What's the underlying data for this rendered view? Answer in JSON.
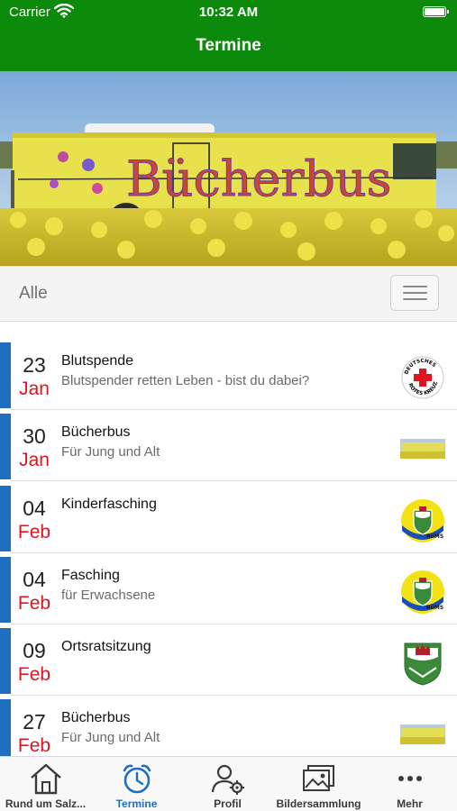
{
  "status": {
    "carrier": "Carrier",
    "time": "10:32 AM"
  },
  "nav": {
    "title": "Termine"
  },
  "banner": {
    "bus_text": "Bücherbus"
  },
  "filter": {
    "label": "Alle",
    "menu_icon": "hamburger-icon"
  },
  "events": [
    {
      "day": "23",
      "month": "Jan",
      "title": "Blutspende",
      "subtitle": "Blutspender retten Leben - bist du dabei?",
      "thumb": "drk-logo",
      "thumb_text": "DEUTSCHES ROTES KREUZ"
    },
    {
      "day": "30",
      "month": "Jan",
      "title": "Bücherbus",
      "subtitle": "Für Jung und Alt",
      "thumb": "bus-photo"
    },
    {
      "day": "04",
      "month": "Feb",
      "title": "Kinderfasching",
      "subtitle": "",
      "thumb": "carnival-club-logo",
      "thumb_text": "RüMS"
    },
    {
      "day": "04",
      "month": "Feb",
      "title": "Fasching",
      "subtitle": "für Erwachsene",
      "thumb": "carnival-club-logo",
      "thumb_text": "RüMS"
    },
    {
      "day": "09",
      "month": "Feb",
      "title": "Ortsratsitzung",
      "subtitle": "",
      "thumb": "coat-of-arms"
    },
    {
      "day": "27",
      "month": "Feb",
      "title": "Bücherbus",
      "subtitle": "Für Jung und Alt",
      "thumb": "bus-photo"
    }
  ],
  "tabs": [
    {
      "label": "Rund um Salz...",
      "icon": "home-icon",
      "active": false
    },
    {
      "label": "Termine",
      "icon": "alarm-clock-icon",
      "active": true
    },
    {
      "label": "Profil",
      "icon": "profile-settings-icon",
      "active": false
    },
    {
      "label": "Bildersammlung",
      "icon": "photo-gallery-icon",
      "active": false
    },
    {
      "label": "Mehr",
      "icon": "more-icon",
      "active": false
    }
  ],
  "colors": {
    "header": "#0b8a0b",
    "accent": "#1f6fc1",
    "month": "#e0141e"
  }
}
